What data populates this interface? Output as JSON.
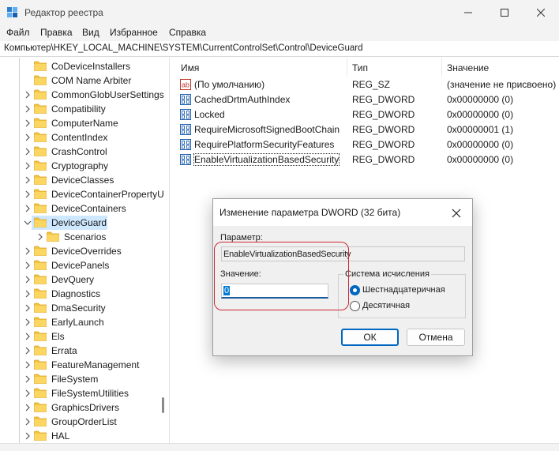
{
  "window": {
    "title": "Редактор реестра",
    "minimize_icon": "minimize-icon",
    "maximize_icon": "maximize-icon",
    "close_icon": "close-icon"
  },
  "menu": [
    "Файл",
    "Правка",
    "Вид",
    "Избранное",
    "Справка"
  ],
  "address": "Компьютер\\HKEY_LOCAL_MACHINE\\SYSTEM\\CurrentControlSet\\Control\\DeviceGuard",
  "tree": {
    "items": [
      {
        "label": "CoDeviceInstallers",
        "expandable": false,
        "selected": false
      },
      {
        "label": "COM Name Arbiter",
        "expandable": false,
        "selected": false
      },
      {
        "label": "CommonGlobUserSettings",
        "expandable": true,
        "selected": false
      },
      {
        "label": "Compatibility",
        "expandable": true,
        "selected": false
      },
      {
        "label": "ComputerName",
        "expandable": true,
        "selected": false
      },
      {
        "label": "ContentIndex",
        "expandable": true,
        "selected": false
      },
      {
        "label": "CrashControl",
        "expandable": true,
        "selected": false
      },
      {
        "label": "Cryptography",
        "expandable": true,
        "selected": false
      },
      {
        "label": "DeviceClasses",
        "expandable": true,
        "selected": false
      },
      {
        "label": "DeviceContainerPropertyU",
        "expandable": true,
        "selected": false
      },
      {
        "label": "DeviceContainers",
        "expandable": true,
        "selected": false
      },
      {
        "label": "DeviceGuard",
        "expandable": true,
        "expanded": true,
        "selected": true
      },
      {
        "label": "Scenarios",
        "expandable": true,
        "selected": false,
        "child": true
      },
      {
        "label": "DeviceOverrides",
        "expandable": true,
        "selected": false
      },
      {
        "label": "DevicePanels",
        "expandable": true,
        "selected": false
      },
      {
        "label": "DevQuery",
        "expandable": true,
        "selected": false
      },
      {
        "label": "Diagnostics",
        "expandable": true,
        "selected": false
      },
      {
        "label": "DmaSecurity",
        "expandable": true,
        "selected": false
      },
      {
        "label": "EarlyLaunch",
        "expandable": true,
        "selected": false
      },
      {
        "label": "Els",
        "expandable": true,
        "selected": false
      },
      {
        "label": "Errata",
        "expandable": true,
        "selected": false
      },
      {
        "label": "FeatureManagement",
        "expandable": true,
        "selected": false
      },
      {
        "label": "FileSystem",
        "expandable": true,
        "selected": false
      },
      {
        "label": "FileSystemUtilities",
        "expandable": true,
        "selected": false
      },
      {
        "label": "GraphicsDrivers",
        "expandable": true,
        "selected": false
      },
      {
        "label": "GroupOrderList",
        "expandable": true,
        "selected": false
      },
      {
        "label": "HAL",
        "expandable": true,
        "selected": false
      }
    ]
  },
  "values_pane": {
    "columns": {
      "name": "Имя",
      "type": "Тип",
      "data": "Значение"
    },
    "rows": [
      {
        "icon": "string-value-icon",
        "name": "(По умолчанию)",
        "type": "REG_SZ",
        "data": "(значение не присвоено)"
      },
      {
        "icon": "binary-value-icon",
        "name": "CachedDrtmAuthIndex",
        "type": "REG_DWORD",
        "data": "0x00000000 (0)"
      },
      {
        "icon": "binary-value-icon",
        "name": "Locked",
        "type": "REG_DWORD",
        "data": "0x00000000 (0)"
      },
      {
        "icon": "binary-value-icon",
        "name": "RequireMicrosoftSignedBootChain",
        "type": "REG_DWORD",
        "data": "0x00000001 (1)"
      },
      {
        "icon": "binary-value-icon",
        "name": "RequirePlatformSecurityFeatures",
        "type": "REG_DWORD",
        "data": "0x00000000 (0)"
      },
      {
        "icon": "binary-value-icon",
        "name": "EnableVirtualizationBasedSecurity",
        "type": "REG_DWORD",
        "data": "0x00000000 (0)"
      }
    ]
  },
  "dialog": {
    "title": "Изменение параметра DWORD (32 бита)",
    "param_label": "Параметр:",
    "param_value": "EnableVirtualizationBasedSecurity",
    "value_label": "Значение:",
    "value_input": "0",
    "base_group_label": "Система исчисления",
    "radio_hex": "Шестнадцатеричная",
    "radio_dec": "Десятичная",
    "base_selected": "hex",
    "ok": "ОК",
    "cancel": "Отмена"
  },
  "colors": {
    "selection": "#cde8ff",
    "accent": "#0067c0",
    "annotation": "#c92a36",
    "folder": "#f5c542"
  }
}
